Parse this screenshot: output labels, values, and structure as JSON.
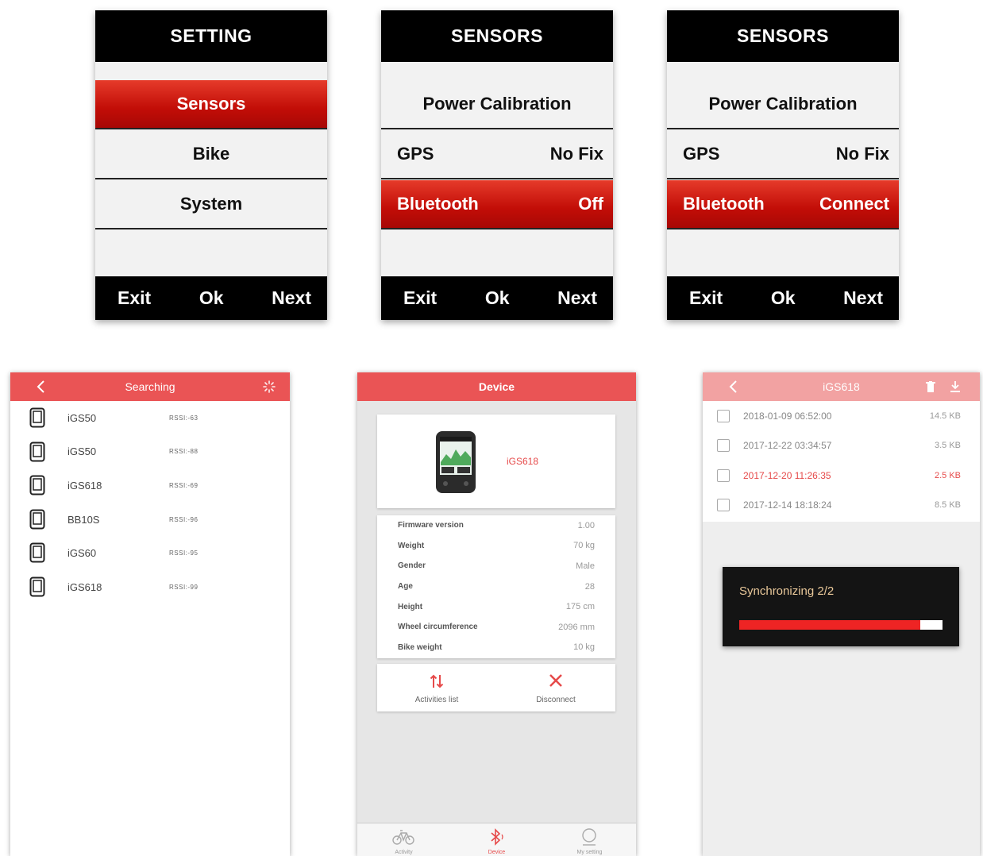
{
  "device_screens": [
    {
      "title": "SETTING",
      "rows": [
        {
          "label": "Sensors",
          "value": "",
          "selected": true
        },
        {
          "label": "Bike",
          "value": "",
          "selected": false
        },
        {
          "label": "System",
          "value": "",
          "selected": false
        }
      ],
      "footer": [
        "Exit",
        "Ok",
        "Next"
      ]
    },
    {
      "title": "SENSORS",
      "rows": [
        {
          "label": "Power Calibration",
          "value": "",
          "selected": false
        },
        {
          "label": "GPS",
          "value": "No Fix",
          "selected": false
        },
        {
          "label": "Bluetooth",
          "value": "Off",
          "selected": true
        }
      ],
      "footer": [
        "Exit",
        "Ok",
        "Next"
      ]
    },
    {
      "title": "SENSORS",
      "rows": [
        {
          "label": "Power Calibration",
          "value": "",
          "selected": false
        },
        {
          "label": "GPS",
          "value": "No Fix",
          "selected": false
        },
        {
          "label": "Bluetooth",
          "value": "Connect",
          "selected": true
        }
      ],
      "footer": [
        "Exit",
        "Ok",
        "Next"
      ]
    }
  ],
  "searching_screen": {
    "title": "Searching",
    "devices": [
      {
        "name": "iGS50",
        "rssi": "RSSI:-63"
      },
      {
        "name": "iGS50",
        "rssi": "RSSI:-88"
      },
      {
        "name": "iGS618",
        "rssi": "RSSI:-69"
      },
      {
        "name": "BB10S",
        "rssi": "RSSI:-96"
      },
      {
        "name": "iGS60",
        "rssi": "RSSI:-95"
      },
      {
        "name": "iGS618",
        "rssi": "RSSI:-99"
      }
    ]
  },
  "device_screen": {
    "title": "Device",
    "device_name": "iGS618",
    "info": [
      {
        "label": "Firmware version",
        "value": "1.00"
      },
      {
        "label": "Weight",
        "value": "70 kg"
      },
      {
        "label": "Gender",
        "value": "Male"
      },
      {
        "label": "Age",
        "value": "28"
      },
      {
        "label": "Height",
        "value": "175 cm"
      },
      {
        "label": "Wheel circumference",
        "value": "2096 mm"
      },
      {
        "label": "Bike weight",
        "value": "10 kg"
      }
    ],
    "actions": {
      "activities": "Activities list",
      "disconnect": "Disconnect"
    },
    "tabs": {
      "activity": "Activity",
      "device": "Device",
      "settings": "My setting"
    }
  },
  "activities_screen": {
    "title": "iGS618",
    "activities": [
      {
        "date": "2018-01-09 06:52:00",
        "size": "14.5 KB",
        "highlighted": false
      },
      {
        "date": "2017-12-22 03:34:57",
        "size": "3.5 KB",
        "highlighted": false
      },
      {
        "date": "2017-12-20 11:26:35",
        "size": "2.5 KB",
        "highlighted": true
      },
      {
        "date": "2017-12-14 18:18:24",
        "size": "8.5 KB",
        "highlighted": false
      }
    ],
    "sync_text": "Synchronizing 2/2",
    "sync_progress": 0.89
  },
  "colors": {
    "accent_red": "#ea5455",
    "device_selected_red": "#c20d07",
    "highlight_red": "#e64a4a",
    "sync_text": "#e9c89a"
  }
}
